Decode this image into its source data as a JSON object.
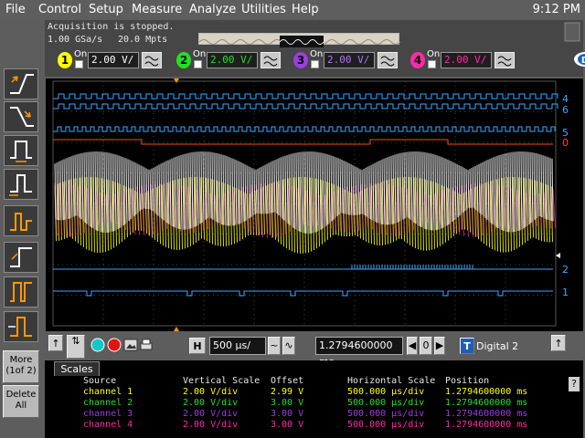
{
  "menu": {
    "items": [
      "File",
      "Control",
      "Setup",
      "Measure",
      "Analyze",
      "Utilities",
      "Help"
    ],
    "clock": "9:12 PM"
  },
  "status": {
    "line1": "Acquisition is stopped.",
    "rate": "1.00 GSa/s",
    "points": "20.0 Mpts"
  },
  "channels": [
    {
      "num": "1",
      "on": "On",
      "scale": "2.00 V/",
      "color": "#ffff00"
    },
    {
      "num": "2",
      "on": "On",
      "scale": "2.00 V/",
      "color": "#22e022"
    },
    {
      "num": "3",
      "on": "On",
      "scale": "2.00 V/",
      "color": "#9b3de0"
    },
    {
      "num": "4",
      "on": "On",
      "scale": "2.00 V/",
      "color": "#ff2aa8"
    }
  ],
  "digital_labels": [
    "4",
    "6",
    "5",
    "0",
    "2",
    "1"
  ],
  "left_panel": {
    "more_label": "More",
    "more_sub": "(1of 2)",
    "delete_label": "Delete",
    "delete_sub": "All"
  },
  "controls": {
    "h_label": "H",
    "timebase": "500 µs/",
    "position": "1.2794600000 ms",
    "position_index": "0",
    "digital_label": "Digital 2",
    "t_label": "T"
  },
  "scales": {
    "tab": "Scales",
    "headers": [
      "Source",
      "Vertical Scale",
      "Offset",
      "Horizontal Scale",
      "Position"
    ],
    "rows": [
      {
        "source": "channel 1",
        "vscale": "2.00 V/div",
        "offset": "2.99 V",
        "hscale": "500.000 µs/div",
        "position": "1.2794600000 ms"
      },
      {
        "source": "channel 2",
        "vscale": "2.00 V/div",
        "offset": "3.00 V",
        "hscale": "500.000 µs/div",
        "position": "1.2794600000 ms"
      },
      {
        "source": "channel 3",
        "vscale": "2.00 V/div",
        "offset": "3.00 V",
        "hscale": "500.000 µs/div",
        "position": "1.2794600000 ms"
      },
      {
        "source": "channel 4",
        "vscale": "2.00 V/div",
        "offset": "3.00 V",
        "hscale": "500.000 µs/div",
        "position": "1.2794600000 ms"
      }
    ],
    "help": "?"
  },
  "colors": {
    "ch1": "#ffff00",
    "ch2": "#22e022",
    "ch3": "#9b3de0",
    "ch4": "#ff2aa8",
    "digital": "#3aa8ff",
    "digital_red": "#ff4422",
    "trigger": "#ff9900"
  }
}
